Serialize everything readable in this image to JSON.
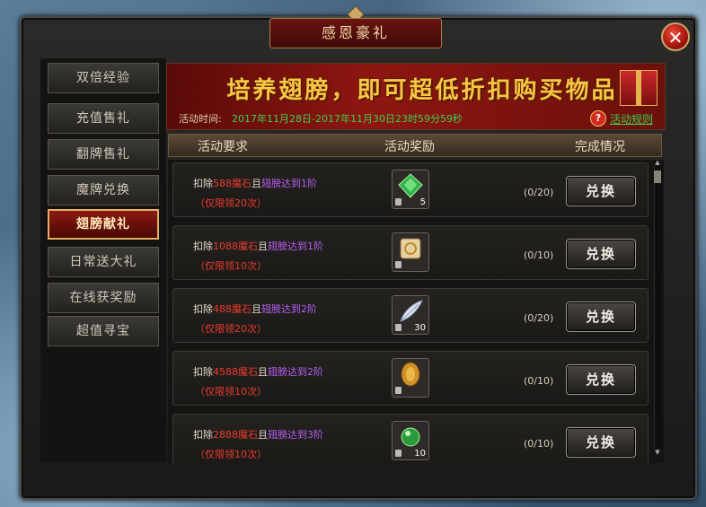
{
  "window": {
    "title": "感恩豪礼",
    "close_glyph": "✕"
  },
  "sidebar": {
    "items": [
      {
        "label": "双倍经验"
      },
      {
        "label": "充值售礼"
      },
      {
        "label": "翻牌售礼"
      },
      {
        "label": "魔牌兑换"
      },
      {
        "label": "翅膀献礼",
        "active": true
      },
      {
        "label": "日常送大礼"
      },
      {
        "label": "在线获奖励"
      },
      {
        "label": "超值寻宝"
      }
    ]
  },
  "banner": {
    "title": "培养翅膀，即可超低折扣购买物品",
    "time_label": "活动时间:",
    "time_value": "2017年11月28日-2017年11月30日23时59分59秒",
    "help_glyph": "?",
    "rule_link": "活动规则"
  },
  "table": {
    "headers": {
      "requirement": "活动要求",
      "reward": "活动奖励",
      "status": "完成情况"
    },
    "rows": [
      {
        "prefix": "扣除",
        "stones": "588",
        "stone_unit": "魔石",
        "joiner": "且",
        "wing_req": "翅膀达到1阶",
        "limit": "（仅限领20次）",
        "item_icon": "green-gem-icon",
        "count": "5",
        "progress": "(0/20)",
        "button": "兑换"
      },
      {
        "prefix": "扣除",
        "stones": "1088",
        "stone_unit": "魔石",
        "joiner": "且",
        "wing_req": "翅膀达到1阶",
        "limit": "（仅限领10次）",
        "item_icon": "scroll-icon",
        "count": "",
        "progress": "(0/10)",
        "button": "兑换"
      },
      {
        "prefix": "扣除",
        "stones": "488",
        "stone_unit": "魔石",
        "joiner": "且",
        "wing_req": "翅膀达到2阶",
        "limit": "（仅限领20次）",
        "item_icon": "feather-icon",
        "count": "30",
        "progress": "(0/20)",
        "button": "兑换"
      },
      {
        "prefix": "扣除",
        "stones": "4588",
        "stone_unit": "魔石",
        "joiner": "且",
        "wing_req": "翅膀达到2阶",
        "limit": "（仅限领10次）",
        "item_icon": "gold-coin-icon",
        "count": "",
        "progress": "(0/10)",
        "button": "兑换"
      },
      {
        "prefix": "扣除",
        "stones": "2888",
        "stone_unit": "魔石",
        "joiner": "且",
        "wing_req": "翅膀达到3阶",
        "limit": "（仅限领10次）",
        "item_icon": "green-orb-icon",
        "count": "10",
        "progress": "(0/10)",
        "button": "兑换"
      }
    ]
  }
}
